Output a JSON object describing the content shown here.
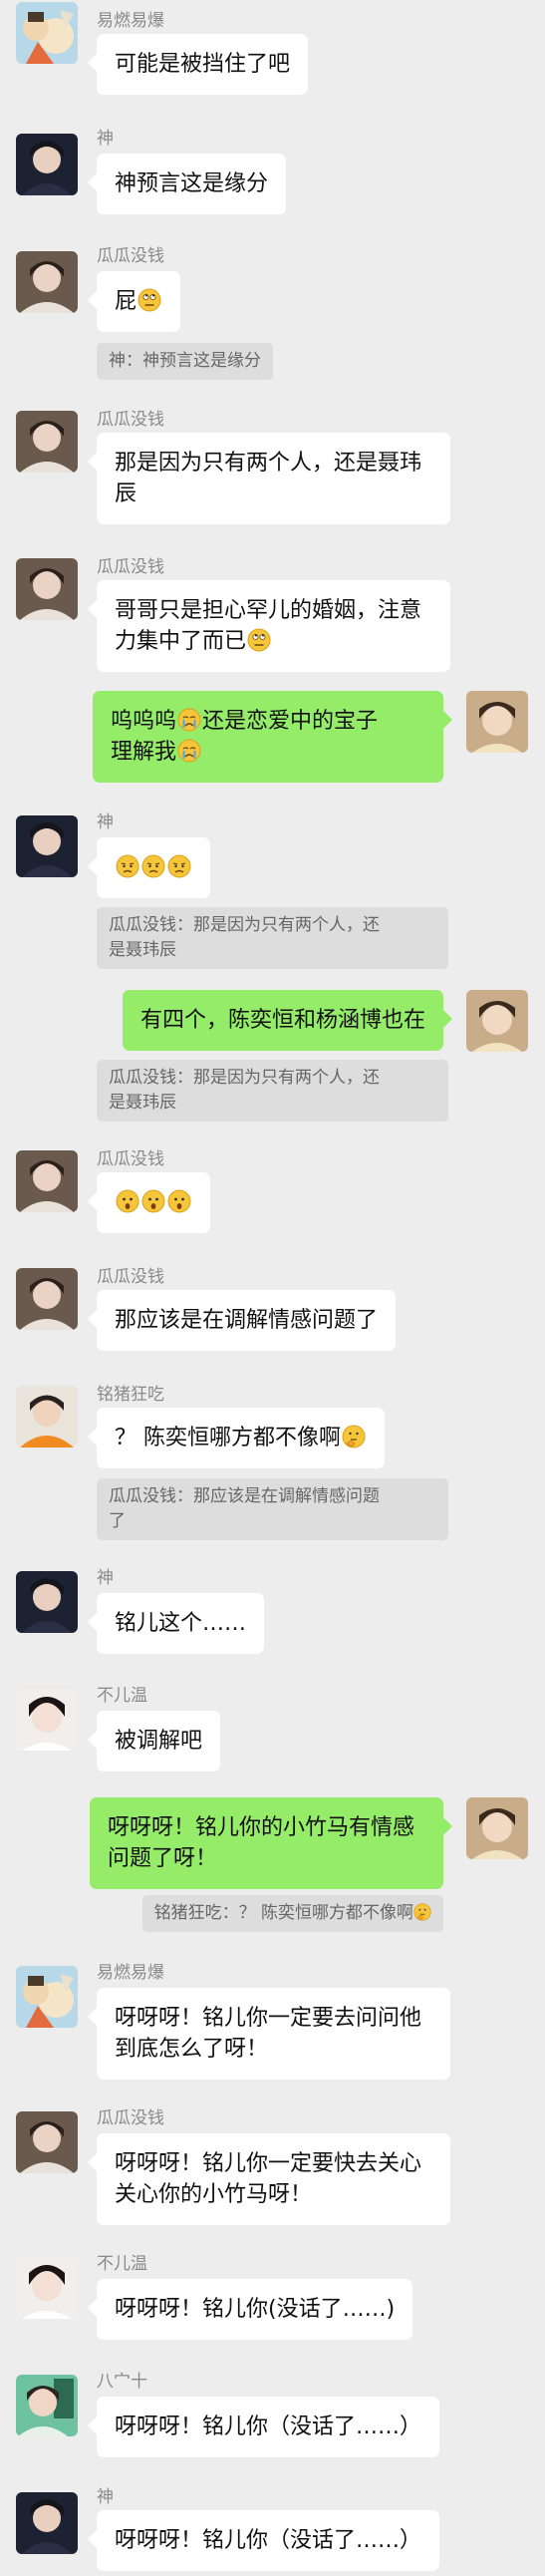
{
  "colors": {
    "background": "#ededed",
    "incoming_bubble": "#ffffff",
    "outgoing_bubble": "#95ec69",
    "quote_bg": "#dddddd"
  },
  "messages": [
    {
      "name": "易燃易爆",
      "text": "可能是被挡住了吧",
      "avatar": "cartoon-avatar"
    },
    {
      "name": "神",
      "text": "神预言这是缘分",
      "avatar": "dark-portrait-avatar"
    },
    {
      "name": "瓜瓜没钱",
      "text": "屁",
      "emoji": "eye-roll-emoji",
      "quote": "神：神预言这是缘分",
      "avatar": "portrait-avatar"
    },
    {
      "name": "瓜瓜没钱",
      "text_lines": [
        "那是因为只有两个人，还是聂玮",
        "辰"
      ],
      "avatar": "portrait-avatar"
    },
    {
      "name": "瓜瓜没钱",
      "text_lines": [
        "哥哥只是担心罕儿的婚姻，注意",
        "力集中了而已"
      ],
      "emoji": "eye-roll-emoji",
      "avatar": "portrait-avatar"
    },
    {
      "name": "",
      "text_lines": [
        "呜呜呜",
        "还是恋爱中的宝子",
        "理解我"
      ],
      "emoji": "crying-emoji",
      "avatar": "self-avatar",
      "outgoing": true
    },
    {
      "name": "神",
      "text": "",
      "emoji": "puzzled-emoji",
      "quote_lines": [
        "瓜瓜没钱：那是因为只有两个人，还",
        "是聂玮辰"
      ],
      "avatar": "dark-portrait-avatar"
    },
    {
      "name": "",
      "text": "有四个，陈奕恒和杨涵博也在",
      "quote_lines": [
        "瓜瓜没钱：那是因为只有两个人，还",
        "是聂玮辰"
      ],
      "avatar": "self-avatar",
      "outgoing": true
    },
    {
      "name": "瓜瓜没钱",
      "text": "",
      "emoji": "surprised-emoji",
      "avatar": "portrait-avatar"
    },
    {
      "name": "瓜瓜没钱",
      "text": "那应该是在调解情感问题了",
      "avatar": "portrait-avatar"
    },
    {
      "name": "铭猪狂吃",
      "text": "？ 陈奕恒哪方都不像啊",
      "emoji": "thinking-emoji",
      "quote_lines": [
        "瓜瓜没钱：那应该是在调解情感问题",
        "了"
      ],
      "avatar": "orange-avatar"
    },
    {
      "name": "神",
      "text": "铭儿这个……",
      "avatar": "dark-portrait-avatar"
    },
    {
      "name": "不儿温",
      "text": "被调解吧",
      "avatar": "light-portrait-avatar"
    },
    {
      "name": "",
      "text_lines": [
        "呀呀呀！铭儿你的小竹马有情感",
        "问题了呀！"
      ],
      "quote": "铭猪狂吃：？ 陈奕恒哪方都不像啊",
      "avatar": "self-avatar",
      "outgoing": true
    },
    {
      "name": "易燃易爆",
      "text_lines": [
        "呀呀呀！铭儿你一定要去问问他",
        "到底怎么了呀！"
      ],
      "avatar": "cartoon-avatar"
    },
    {
      "name": "瓜瓜没钱",
      "text_lines": [
        "呀呀呀！铭儿你一定要快去关心",
        "关心你的小竹马呀！"
      ],
      "avatar": "portrait-avatar"
    },
    {
      "name": "不儿温",
      "text": "呀呀呀！铭儿你(没话了……)",
      "avatar": "light-portrait-avatar"
    },
    {
      "name": "八宀十",
      "text": "呀呀呀！铭儿你（没话了……）",
      "avatar": "green-avatar"
    },
    {
      "name": "神",
      "text": "呀呀呀！铭儿你（没话了……）",
      "avatar": "dark-portrait-avatar"
    }
  ]
}
